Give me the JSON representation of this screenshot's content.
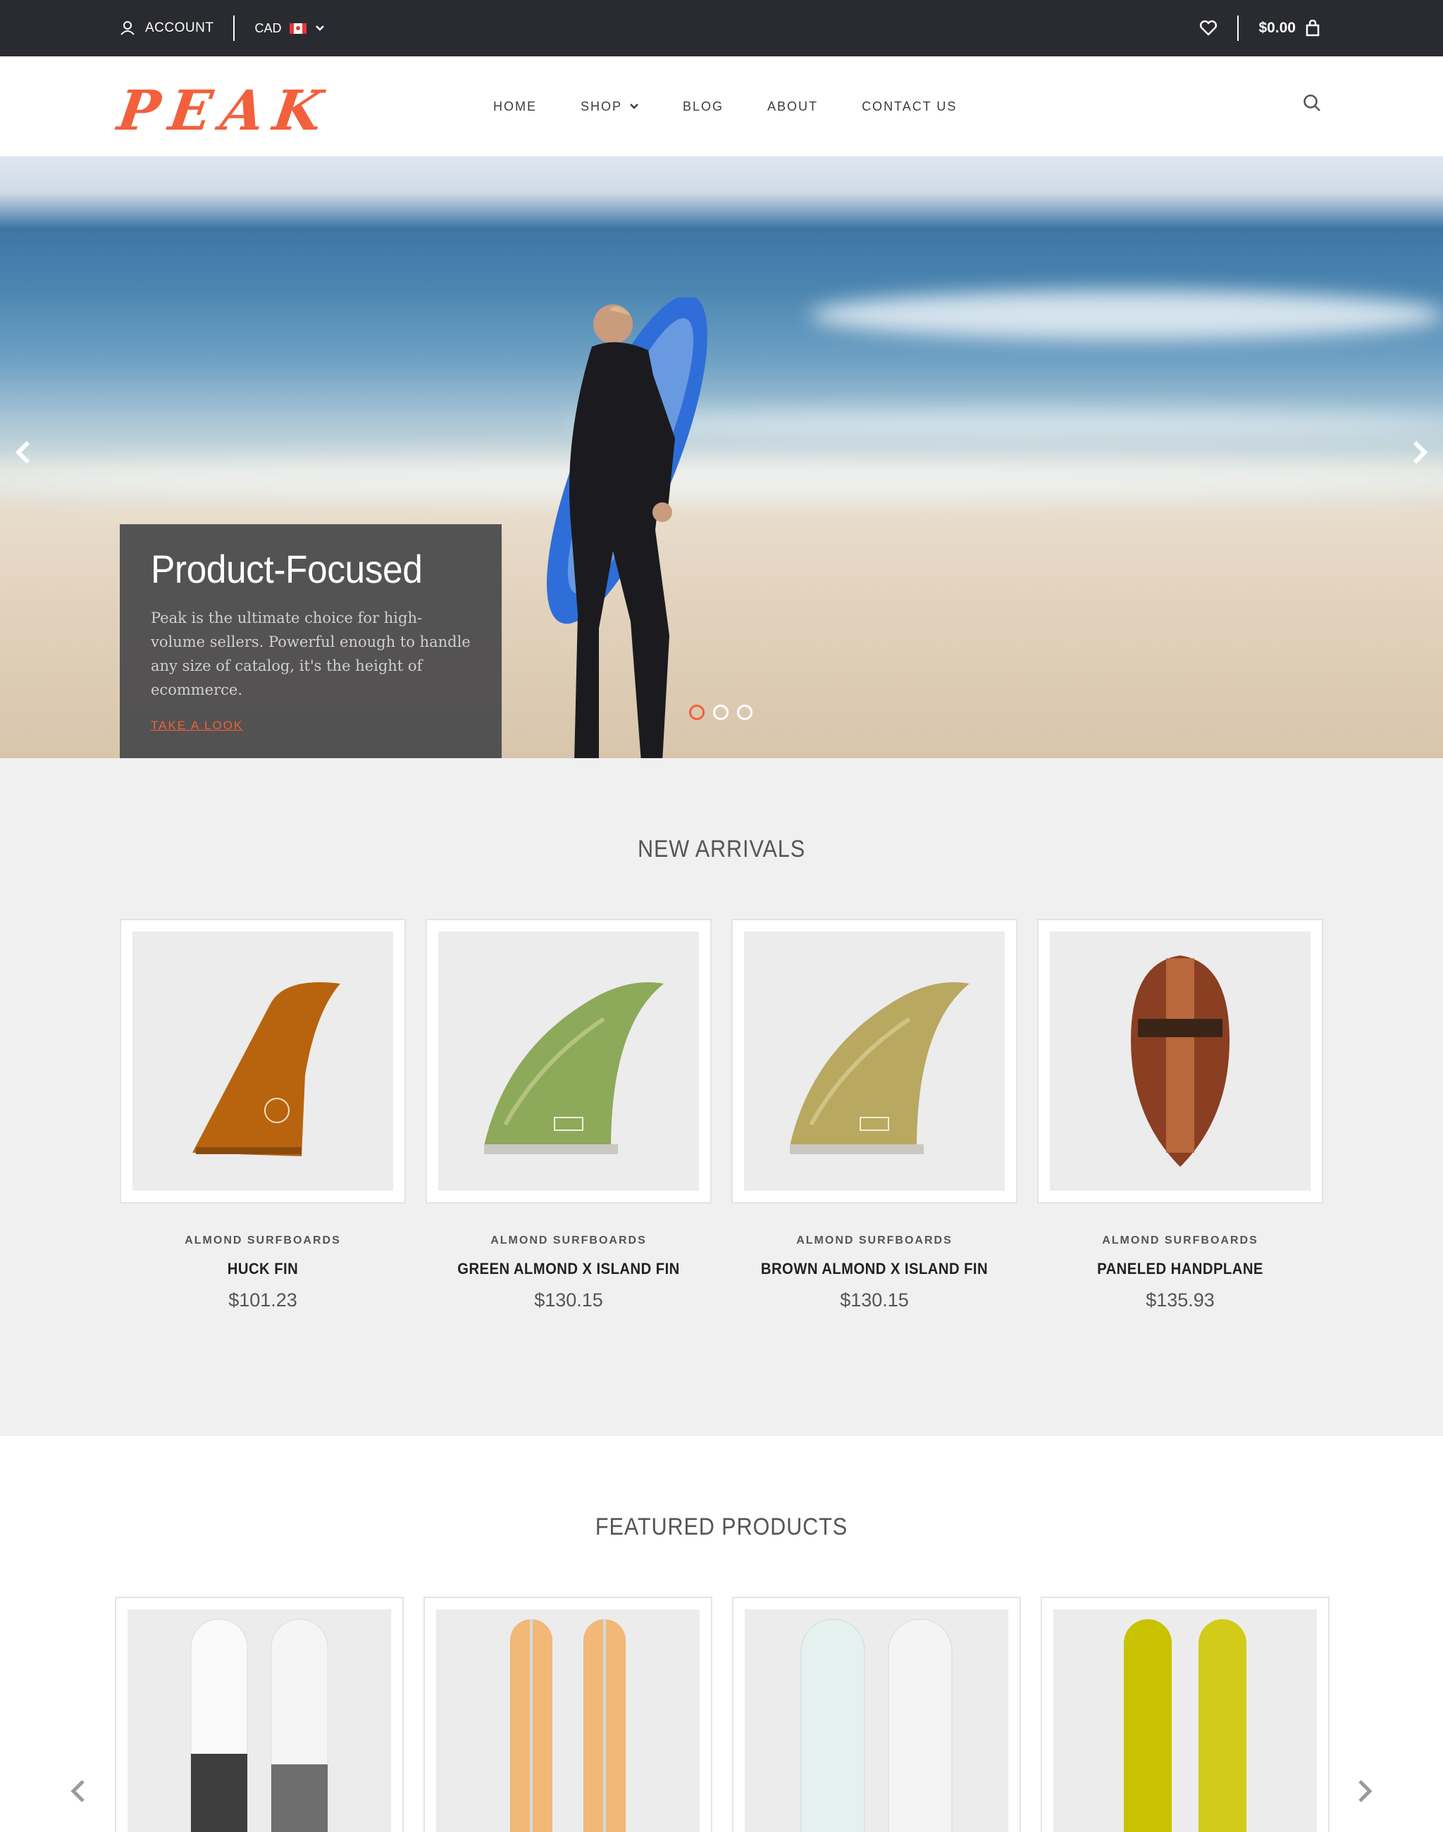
{
  "topbar": {
    "account_label": "ACCOUNT",
    "currency": "CAD",
    "cart_total": "$0.00"
  },
  "header": {
    "logo": "PEAK",
    "nav": [
      {
        "label": "HOME"
      },
      {
        "label": "SHOP"
      },
      {
        "label": "BLOG"
      },
      {
        "label": "ABOUT"
      },
      {
        "label": "CONTACT US"
      }
    ]
  },
  "hero": {
    "title": "Product-Focused",
    "body": "Peak is the ultimate choice for high-volume sellers. Powerful enough to handle any size of catalog, it's the height of ecommerce.",
    "cta": "TAKE A LOOK",
    "slides": 3,
    "active_slide": 1
  },
  "new_arrivals": {
    "title": "NEW ARRIVALS",
    "products": [
      {
        "vendor": "ALMOND SURFBOARDS",
        "name": "HUCK FIN",
        "price": "$101.23"
      },
      {
        "vendor": "ALMOND SURFBOARDS",
        "name": "GREEN ALMOND X ISLAND FIN",
        "price": "$130.15"
      },
      {
        "vendor": "ALMOND SURFBOARDS",
        "name": "BROWN ALMOND X ISLAND FIN",
        "price": "$130.15"
      },
      {
        "vendor": "ALMOND SURFBOARDS",
        "name": "PANELED HANDPLANE",
        "price": "$135.93"
      }
    ]
  },
  "featured": {
    "title": "FEATURED PRODUCTS"
  },
  "colors": {
    "accent": "#f2603c",
    "topbar": "#2a2b30",
    "section_bg": "#f0f0f1"
  },
  "icons": [
    "user-icon",
    "flag-ca-icon",
    "chevron-down-icon",
    "heart-icon",
    "bag-icon",
    "search-icon",
    "chevron-left-icon",
    "chevron-right-icon"
  ]
}
